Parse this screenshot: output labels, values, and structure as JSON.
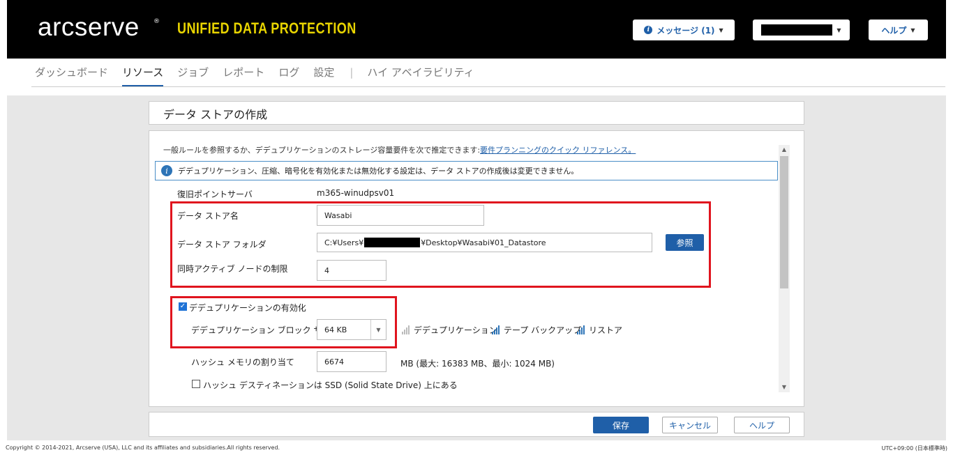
{
  "header": {
    "logo_text": "arcserve",
    "logo_mark": "®",
    "product_name": "UNIFIED DATA PROTECTION",
    "messages_label": "メッセージ (1)",
    "help_label": "ヘルプ"
  },
  "nav": {
    "items": [
      "ダッシュボード",
      "リソース",
      "ジョブ",
      "レポート",
      "ログ",
      "設定"
    ],
    "separator": "|",
    "ha_label": "ハイ アベイラビリティ"
  },
  "page": {
    "title": "データ ストアの作成",
    "intro_text": "一般ルールを参照するか、デデュプリケーションのストレージ容量要件を次で推定できます:",
    "intro_link": "要件プランニングのクイック リファレンス。",
    "notice": "デデュプリケーション、圧縮、暗号化を有効化または無効化する設定は、データ ストアの作成後は変更できません。"
  },
  "form": {
    "rps_label": "復旧ポイントサーバ",
    "rps_value": "m365-winudpsv01",
    "name_label": "データ ストア名",
    "name_value": "Wasabi",
    "folder_label": "データ ストア フォルダ",
    "folder_prefix": "C:¥Users¥",
    "folder_suffix": "¥Desktop¥Wasabi¥01_Datastore",
    "browse_label": "参照",
    "limit_label": "同時アクティブ ノードの制限",
    "limit_value": "4",
    "dedupe_label": "デデュプリケーションの有効化",
    "dedupe_checked": true,
    "block_label": "デデュプリケーション ブロック サイズ",
    "block_value": "64 KB",
    "legend_dedupe": "デデュプリケーション",
    "legend_tape": "テープ バックアップ",
    "legend_restore": "リストア",
    "hash_label": "ハッシュ メモリの割り当て",
    "hash_value": "6674",
    "hash_info": "MB (最大: 16383 MB、最小: 1024 MB)",
    "ssd_label": "ハッシュ デスティネーションは SSD (Solid State Drive) 上にある",
    "ssd_checked": false
  },
  "footer": {
    "save_label": "保存",
    "cancel_label": "キャンセル",
    "help_label": "ヘルプ"
  },
  "status": {
    "copyright": "Copyright © 2014-2021, Arcserve (USA), LLC and its affiliates and subsidiaries.All rights reserved.",
    "timezone": "UTC+09:00 (日本標準時)"
  },
  "colors": {
    "accent": "#1f5fa8",
    "brand_yellow": "#e8d400",
    "highlight_red": "#e0141e"
  }
}
